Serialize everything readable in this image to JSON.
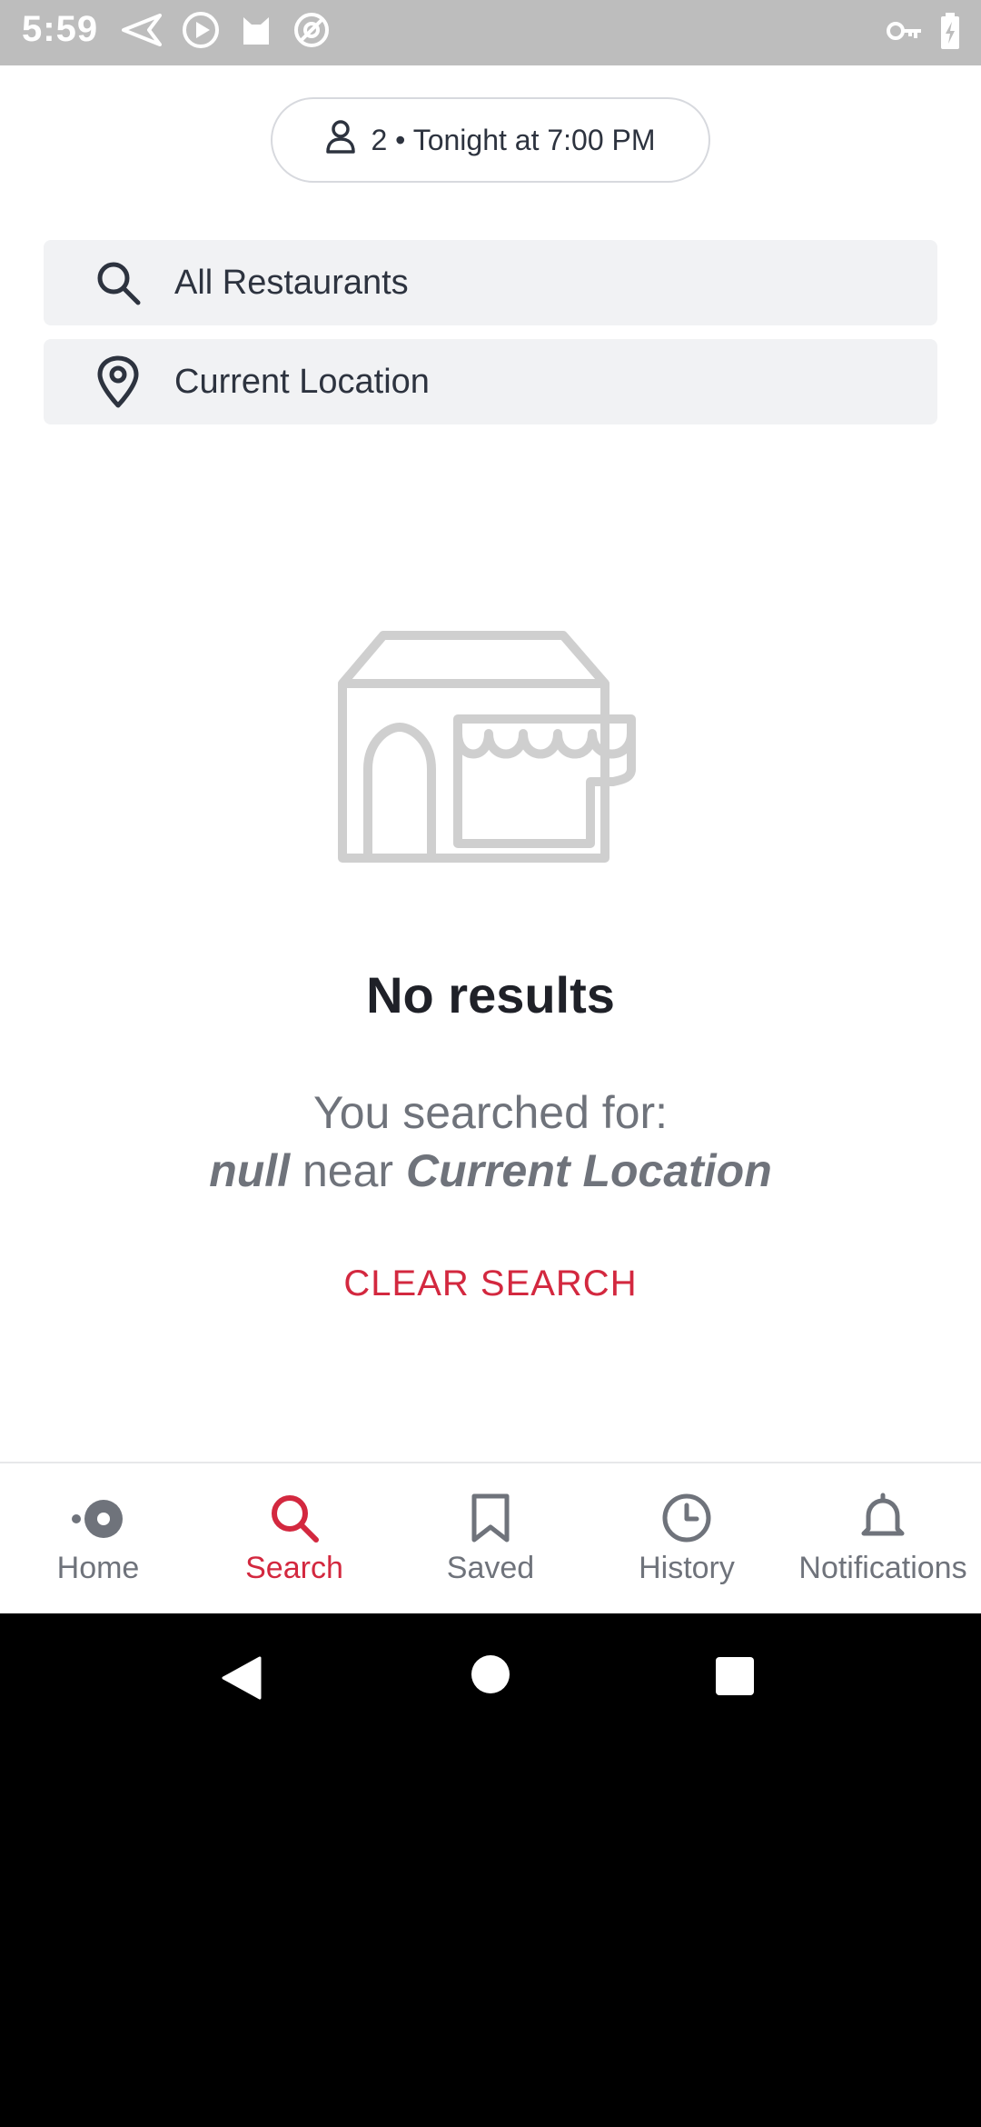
{
  "status_bar": {
    "time": "5:59"
  },
  "party_selector": {
    "label": "2 • Tonight at 7:00 PM"
  },
  "search": {
    "query_value": "All Restaurants",
    "location_value": "Current Location"
  },
  "empty_state": {
    "title": "No results",
    "line1": "You searched for:",
    "query": "null",
    "near": "near",
    "location": "Current Location",
    "clear_label": "CLEAR SEARCH"
  },
  "bottom_nav": {
    "items": [
      {
        "label": "Home",
        "icon": "home-icon"
      },
      {
        "label": "Search",
        "icon": "search-icon",
        "active": true
      },
      {
        "label": "Saved",
        "icon": "bookmark-icon"
      },
      {
        "label": "History",
        "icon": "clock-icon"
      },
      {
        "label": "Notifications",
        "icon": "bell-icon"
      }
    ]
  },
  "colors": {
    "accent": "#d3283f",
    "text_primary": "#2d333f",
    "field_bg": "#f1f2f4",
    "status_bar_bg": "#bdbdbd"
  }
}
